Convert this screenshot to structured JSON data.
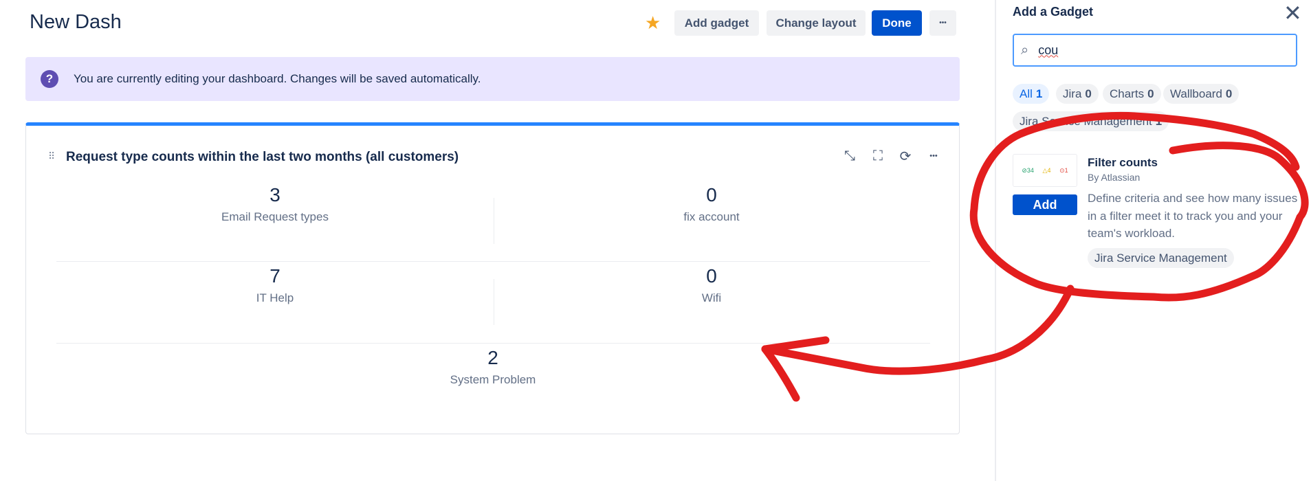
{
  "header": {
    "title": "New Dash",
    "add_gadget": "Add gadget",
    "change_layout": "Change layout",
    "done": "Done",
    "more": "•••"
  },
  "banner": {
    "text": "You are currently editing your dashboard. Changes will be saved automatically."
  },
  "gadget": {
    "title": "Request type counts within the last two months (all customers)",
    "items": [
      {
        "count": "3",
        "label": "Email Request types"
      },
      {
        "count": "0",
        "label": "fix account"
      },
      {
        "count": "7",
        "label": "IT Help"
      },
      {
        "count": "0",
        "label": "Wifi"
      },
      {
        "count": "2",
        "label": "System Problem"
      }
    ]
  },
  "sidebar": {
    "title": "Add a Gadget",
    "search_value": "cou",
    "filters": [
      {
        "label": "All",
        "count": "1"
      },
      {
        "label": "Jira",
        "count": "0"
      },
      {
        "label": "Charts",
        "count": "0"
      },
      {
        "label": "Wallboard",
        "count": "0"
      },
      {
        "label": "Jira Service Management",
        "count": "1"
      }
    ],
    "result": {
      "name": "Filter counts",
      "author": "By Atlassian",
      "description": "Define criteria and see how many issues in a filter meet it to track you and your team's workload.",
      "tag": "Jira Service Management",
      "add": "Add",
      "thumb": [
        "34",
        "4",
        "1"
      ]
    }
  },
  "colors": {
    "accent": "#0052cc",
    "annotation": "#e31e1e",
    "banner": "#e9e5ff"
  }
}
